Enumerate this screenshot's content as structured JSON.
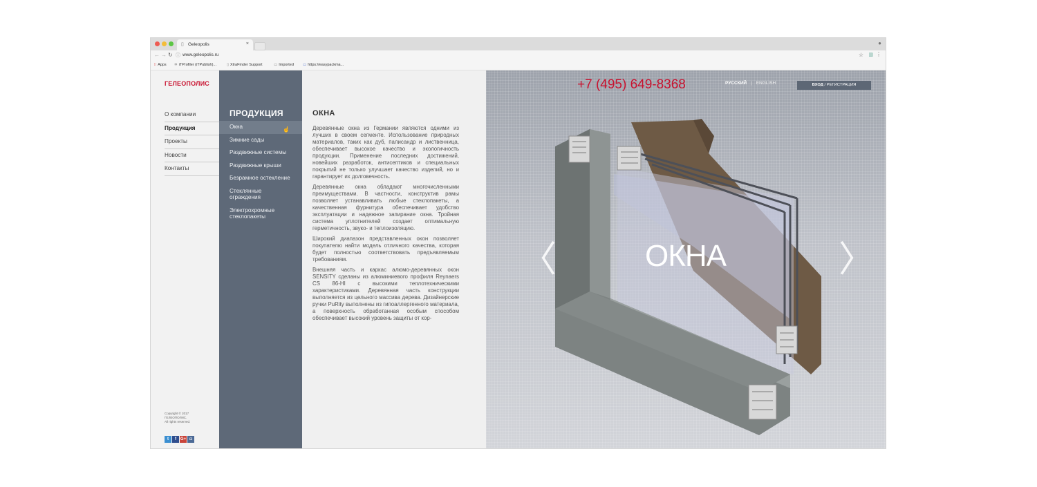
{
  "browser": {
    "tab_title": "Geleopolis",
    "tab_close": "×",
    "url": "www.geleopolis.ru",
    "bookmarks": [
      {
        "icon": "apps-icon",
        "label": "Apps"
      },
      {
        "icon": "gear-icon",
        "label": "iTProfiler (iTPublish)..."
      },
      {
        "icon": "page-icon",
        "label": "XtraFinder Support"
      },
      {
        "icon": "folder-icon",
        "label": "Imported"
      },
      {
        "icon": "link-icon",
        "label": "https://easypackma..."
      }
    ]
  },
  "site": {
    "logo": "ГЕЛЕОПОЛИС",
    "nav": [
      {
        "label": "О компании"
      },
      {
        "label": "Продукция",
        "active": true
      },
      {
        "label": "Проекты"
      },
      {
        "label": "Новости"
      },
      {
        "label": "Контакты"
      }
    ],
    "copyright": [
      "Copyright © 2017",
      "ГЕЛЕОПОЛИС.",
      "All rights reserved."
    ],
    "social": [
      {
        "name": "twitter",
        "glyph": "t",
        "color": "#3b8fd1"
      },
      {
        "name": "facebook",
        "glyph": "f",
        "color": "#2f4e8e"
      },
      {
        "name": "google-plus",
        "glyph": "G+",
        "color": "#c9443a"
      },
      {
        "name": "instagram",
        "glyph": "◘",
        "color": "#4c6a96"
      }
    ]
  },
  "subnav": {
    "title": "ПРОДУКЦИЯ",
    "items": [
      {
        "label": "Окна",
        "active": true
      },
      {
        "label": "Зимние сады"
      },
      {
        "label": "Раздвижные системы"
      },
      {
        "label": "Раздвижные крыши"
      },
      {
        "label": "Безрамное остекление"
      },
      {
        "label": "Стеклянные ограждения"
      },
      {
        "label": "Электрохромные стеклопакеты"
      }
    ]
  },
  "content": {
    "title": "ОКНА",
    "paragraphs": [
      "Деревянные окна из Германии являются одними из лучших в своем сегменте. Использование природных материалов, таких как дуб, палисандр и лиственница, обеспечивает высокое качество и экологичность продукции. Применение последних достижений, новейших разработок, антисептиков и специальных покрытий не только улучшает качество изделий, но и гарантирует их долговечность.",
      "Деревянные окна обладают многочисленными преимуществами. В частности, конструктив рамы позволяет устанавливать любые стеклопакеты, а качественная фурнитура обеспечивает удобство эксплуатации и надежное запирание окна. Тройная система уплотнителей создает оптимальную герметичность, звуко- и теплоизоляцию.",
      "Широкий диапазон представленных окон позволяет покупателю найти модель отличного качества, которая будет полностью соответствовать предъявляемым требованиям.",
      "Внешняя часть и каркас алюмо-деревянных окон SENSITY сделаны из алюминиевого профиля Reynaers CS 86-HI с высокими теплотехническими характеристиками. Деревянная часть конструкции выполняется из цельного массива дерева. Дизайнерские ручки PuRity выполнены из гипоаллергенного материала, а поверхность обработанная особым способом обеспечивает высокий уровень защиты от кор-"
    ]
  },
  "hero": {
    "phone": "+7 (495) 649-8368",
    "lang_ru": "РУССКИЙ",
    "lang_sep": "|",
    "lang_en": "ENGLISH",
    "login_main": "ВХОД",
    "login_rest": " / РЕГИСТРАЦИЯ",
    "title": "ОКНА",
    "prev": "〈",
    "next": "〉"
  },
  "colors": {
    "brand_red": "#c8112e",
    "subnav_bg": "#5e6978",
    "subnav_active": "#727d8b"
  }
}
